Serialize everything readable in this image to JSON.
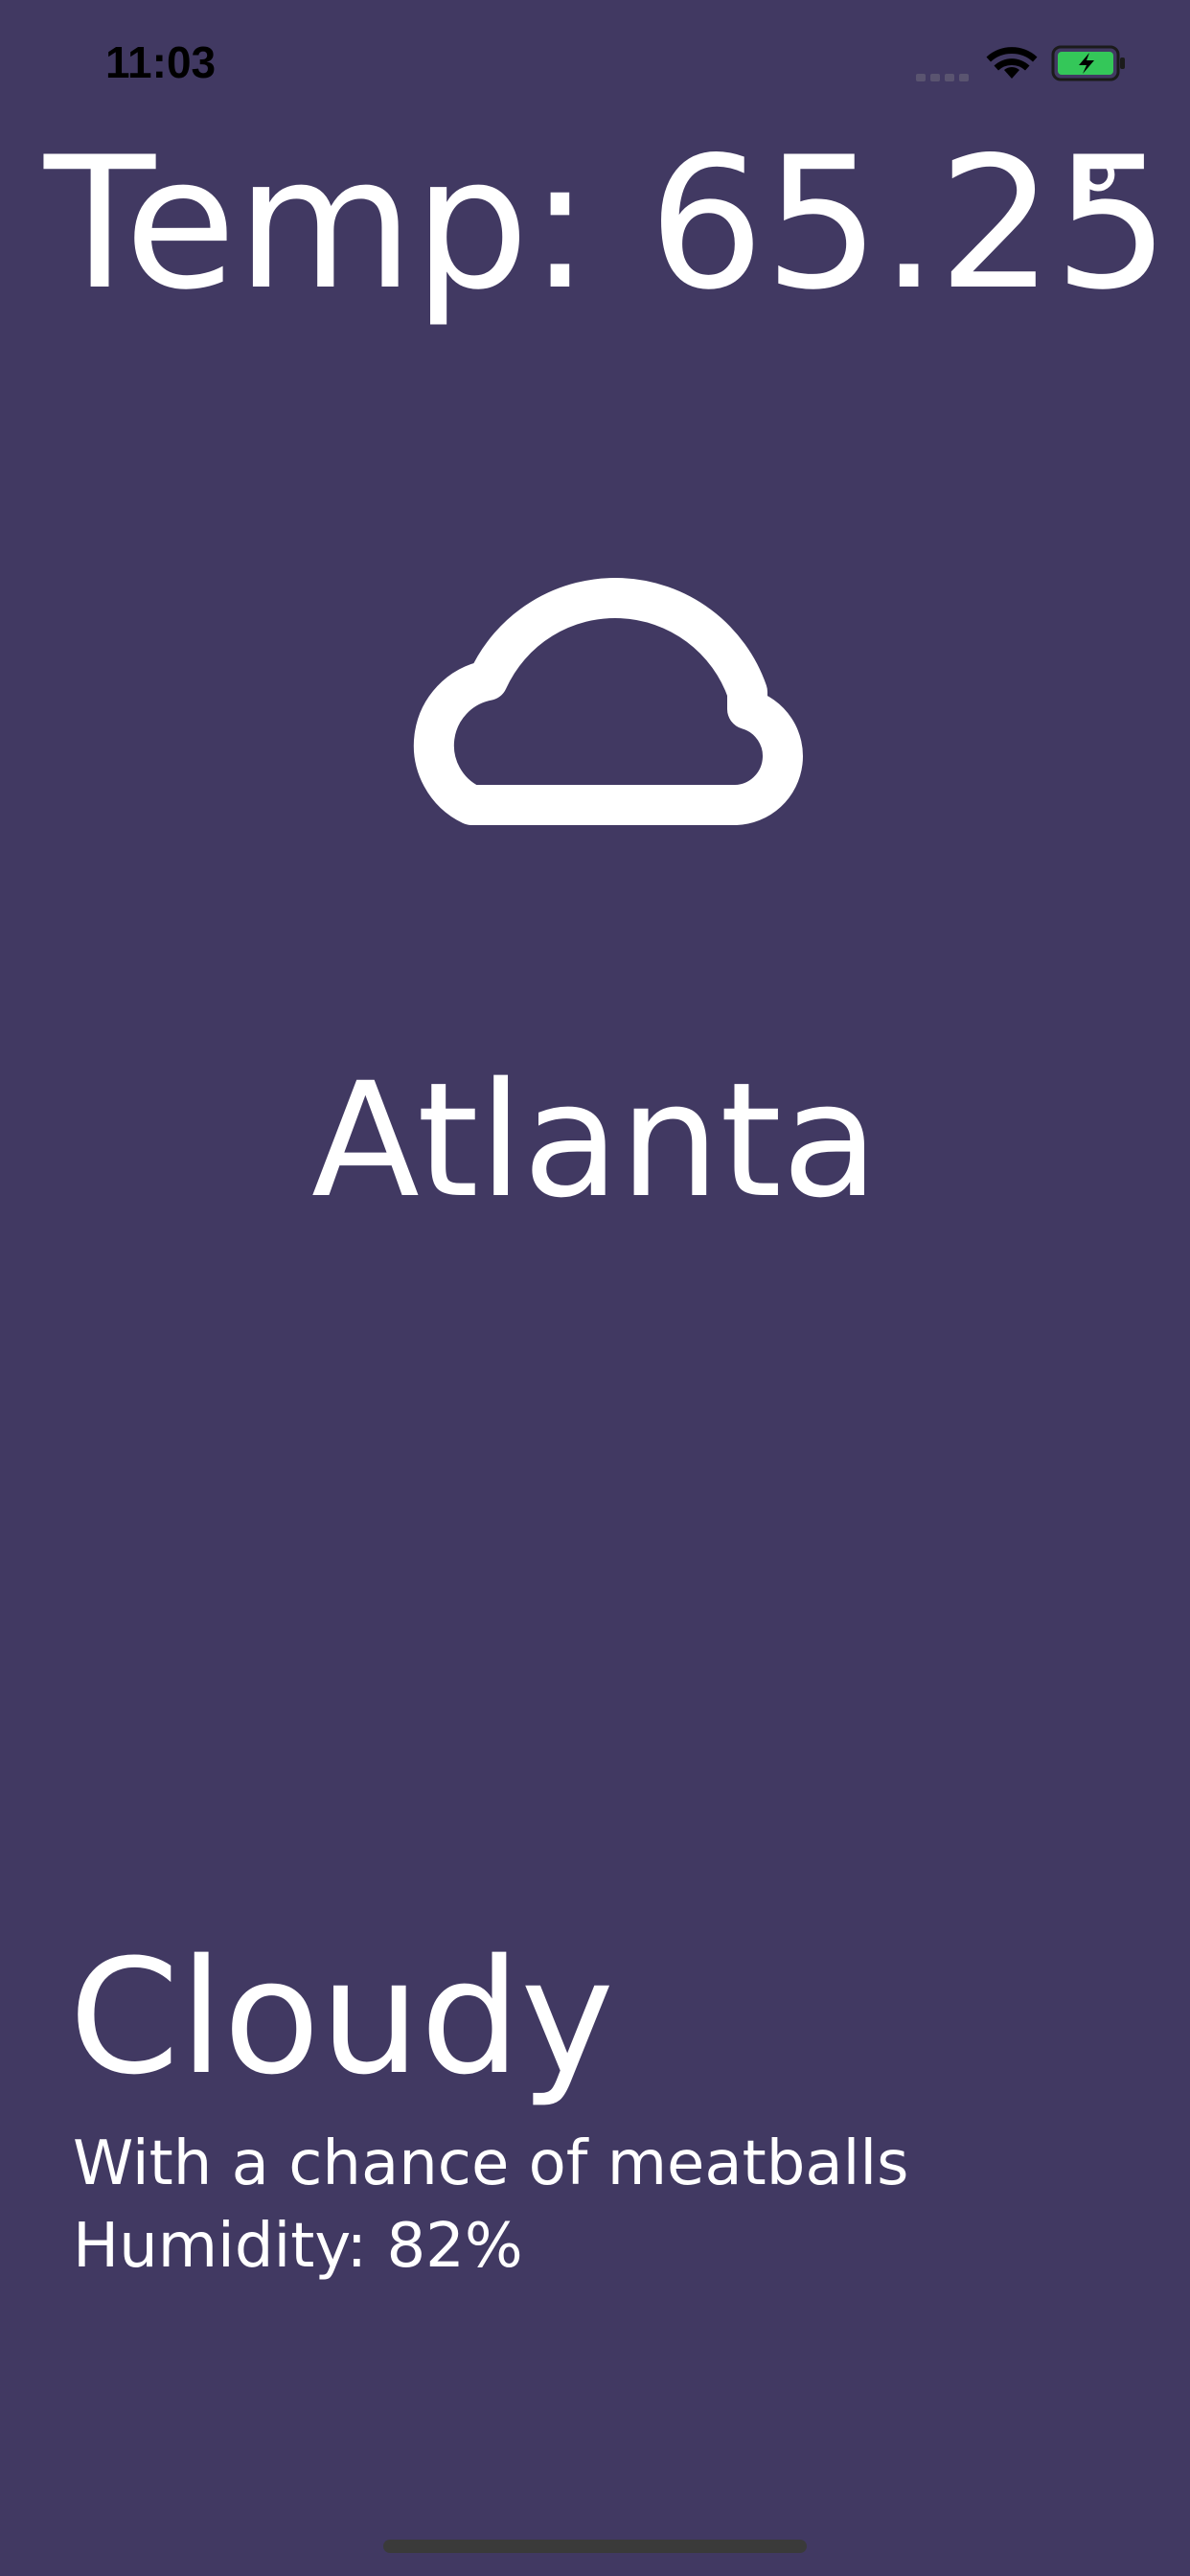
{
  "status_bar": {
    "time": "11:03",
    "icons": [
      "cellular-signal-icon",
      "wifi-icon",
      "battery-charging-icon"
    ],
    "battery_color": "#34c759"
  },
  "weather": {
    "temperature_text": "Temp: 65.25",
    "degree_symbol": "°",
    "icon": "cloud-icon",
    "city": "Atlanta",
    "condition": "Cloudy",
    "description": "With a chance of meatballs",
    "humidity_text": "Humidity: 82%"
  },
  "colors": {
    "background": "#413962",
    "text": "#ffffff",
    "home_indicator": "#3a3a3a"
  }
}
